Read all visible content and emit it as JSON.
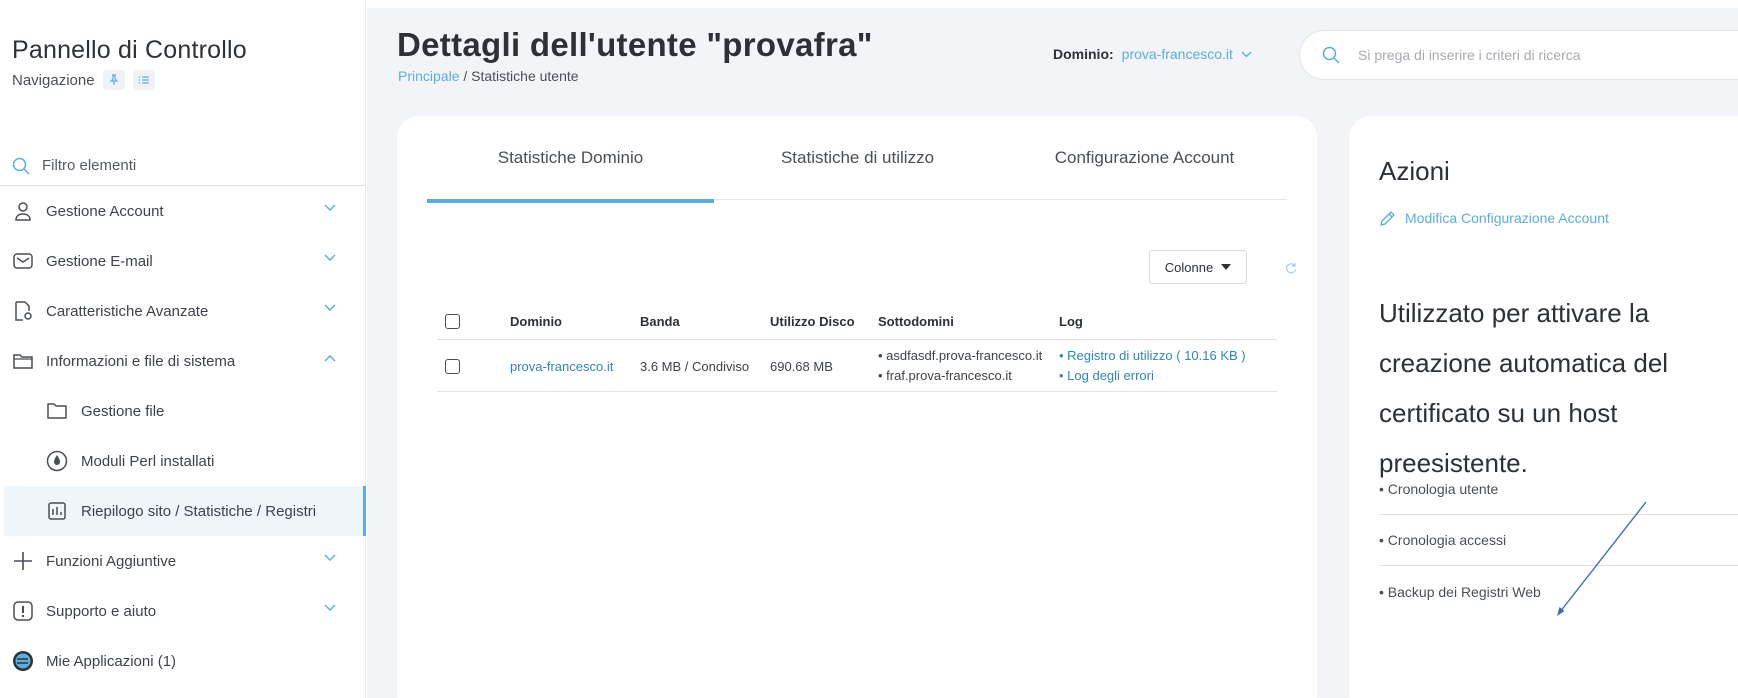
{
  "sidebar": {
    "title": "Pannello di Controllo",
    "subtitle": "Navigazione",
    "filter_placeholder": "Filtro elementi",
    "items": [
      {
        "label": "Gestione Account"
      },
      {
        "label": "Gestione E-mail"
      },
      {
        "label": "Caratteristiche Avanzate"
      },
      {
        "label": "Informazioni e file di sistema"
      },
      {
        "label": "Funzioni Aggiuntive"
      },
      {
        "label": "Supporto e aiuto"
      },
      {
        "label": "Mie Applicazioni (1)"
      }
    ],
    "subitems": [
      {
        "label": "Gestione file"
      },
      {
        "label": "Moduli Perl installati"
      },
      {
        "label": "Riepilogo sito / Statistiche / Registri"
      }
    ]
  },
  "header": {
    "title": "Dettagli dell'utente \"provafra\"",
    "breadcrumb_home": "Principale",
    "breadcrumb_sep": " / ",
    "breadcrumb_current": "Statistiche utente",
    "domain_label": "Dominio:",
    "domain_value": "prova-francesco.it",
    "search_placeholder": "Si prega di inserire i criteri di ricerca"
  },
  "tabs": [
    {
      "label": "Statistiche Dominio",
      "active": true
    },
    {
      "label": "Statistiche di utilizzo",
      "active": false
    },
    {
      "label": "Configurazione Account",
      "active": false
    }
  ],
  "table": {
    "columns_button": "Colonne",
    "headers": [
      "Dominio",
      "Banda",
      "Utilizzo Disco",
      "Sottodomini",
      "Log"
    ],
    "rows": [
      {
        "dominio": "prova-francesco.it",
        "banda": "3.6 MB / Condiviso",
        "disco": "690.68 MB",
        "sottodomini": [
          "• asdfasdf.prova-francesco.it",
          "• fraf.prova-francesco.it"
        ],
        "log": [
          "• Registro di utilizzo ( 10.16 KB )",
          "• Log degli errori"
        ]
      }
    ]
  },
  "azioni": {
    "title": "Azioni",
    "action": "Modifica Configurazione Account",
    "description": "Utilizzato per attivare la creazione automatica del certificato su un host preesistente.",
    "links": [
      "• Cronologia utente",
      "• Cronologia accessi",
      "• Backup dei Registri Web"
    ]
  },
  "colors": {
    "accent": "#5aaedf",
    "link": "#2f86b8",
    "background": "#f3f4f7"
  }
}
